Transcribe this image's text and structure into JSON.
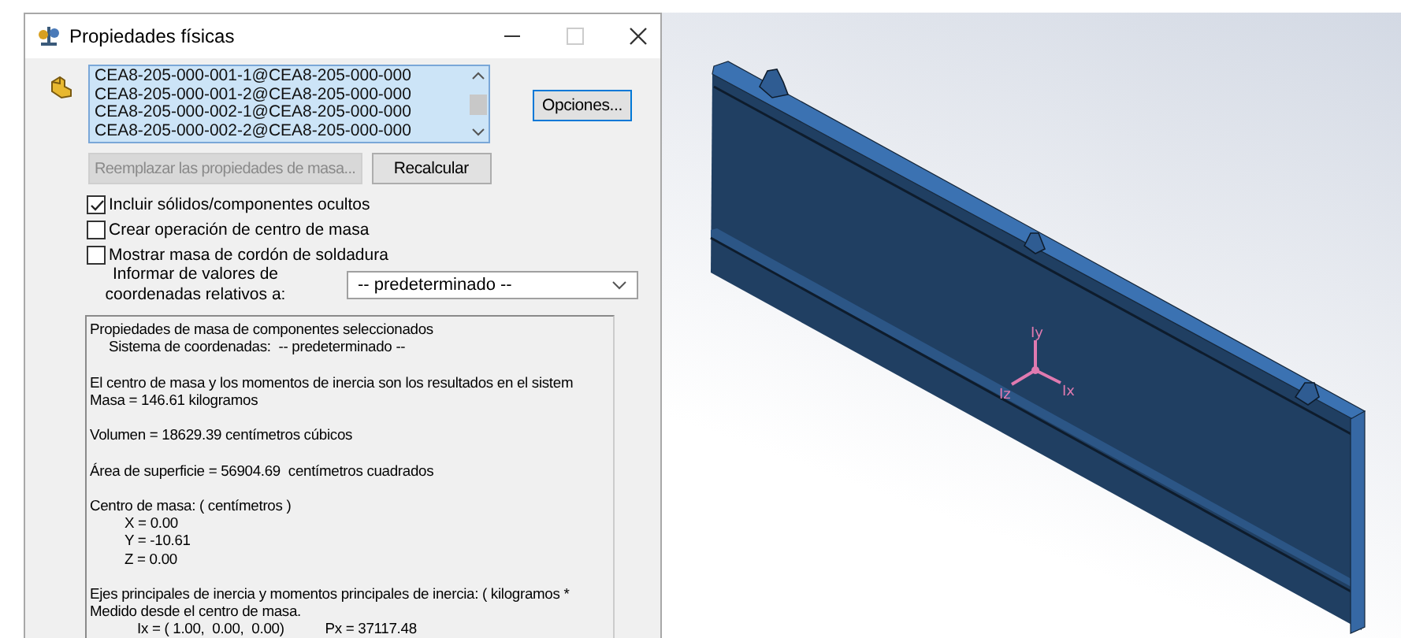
{
  "window": {
    "title": "Propiedades físicas"
  },
  "selection_list": {
    "items": [
      {
        "label": "CEA8-205-000-001-1@CEA8-205-000-000",
        "selected": true
      },
      {
        "label": "CEA8-205-000-001-2@CEA8-205-000-000",
        "selected": true
      },
      {
        "label": "CEA8-205-000-002-1@CEA8-205-000-000",
        "selected": true
      },
      {
        "label": "CEA8-205-000-002-2@CEA8-205-000-000",
        "selected": true
      }
    ]
  },
  "buttons": [
    {
      "label": "Opciones...",
      "kind": "options",
      "disabled": false
    },
    {
      "label": "Reemplazar las propiedades de masa...",
      "kind": "action",
      "disabled": true
    },
    {
      "label": "Recalcular",
      "kind": "action",
      "disabled": false
    }
  ],
  "checkboxes": [
    {
      "label": "Incluir sólidos/componentes ocultos",
      "checked": true
    },
    {
      "label": "Crear operación de centro de masa",
      "checked": false
    },
    {
      "label": "Mostrar masa de cordón de soldadura",
      "checked": false
    }
  ],
  "coordinate_system": {
    "label": "Informar de valores de coordenadas relativos a:",
    "value": "-- predeterminado --"
  },
  "report": {
    "paragraphs": [
      {
        "lines": [
          {
            "text": "Propiedades de masa de componentes seleccionados",
            "children": [
              {
                "text": "Sistema de coordenadas:  -- predeterminado --"
              }
            ]
          }
        ]
      },
      {
        "lines": [
          {
            "text": "El centro de masa y los momentos de inercia son los resultados en el sistem"
          },
          {
            "text": "Masa = 146.61 kilogramos"
          }
        ]
      },
      {
        "lines": [
          {
            "text": "Volumen = 18629.39 centímetros cúbicos"
          }
        ]
      },
      {
        "lines": [
          {
            "text": "Área de superficie = 56904.69  centímetros cuadrados"
          }
        ]
      },
      {
        "lines": [
          {
            "text": "Centro de masa: ( centímetros )",
            "children": [
              {
                "text": "X = 0.00"
              },
              {
                "text": "Y = -10.61"
              },
              {
                "text": "Z = 0.00"
              }
            ]
          }
        ]
      },
      {
        "lines": [
          {
            "text": "Ejes principales de inercia y momentos principales de inercia: ( kilogramos *"
          },
          {
            "text": "Medido desde el centro de masa.",
            "children": [
              {
                "text": "Ix = ( 1.00,  0.00,  0.00)",
                "extra": "Px = 37117.48"
              }
            ]
          }
        ]
      }
    ]
  },
  "viewport": {
    "axis_labels": [
      "Iy",
      "Iz",
      "Ix"
    ]
  }
}
